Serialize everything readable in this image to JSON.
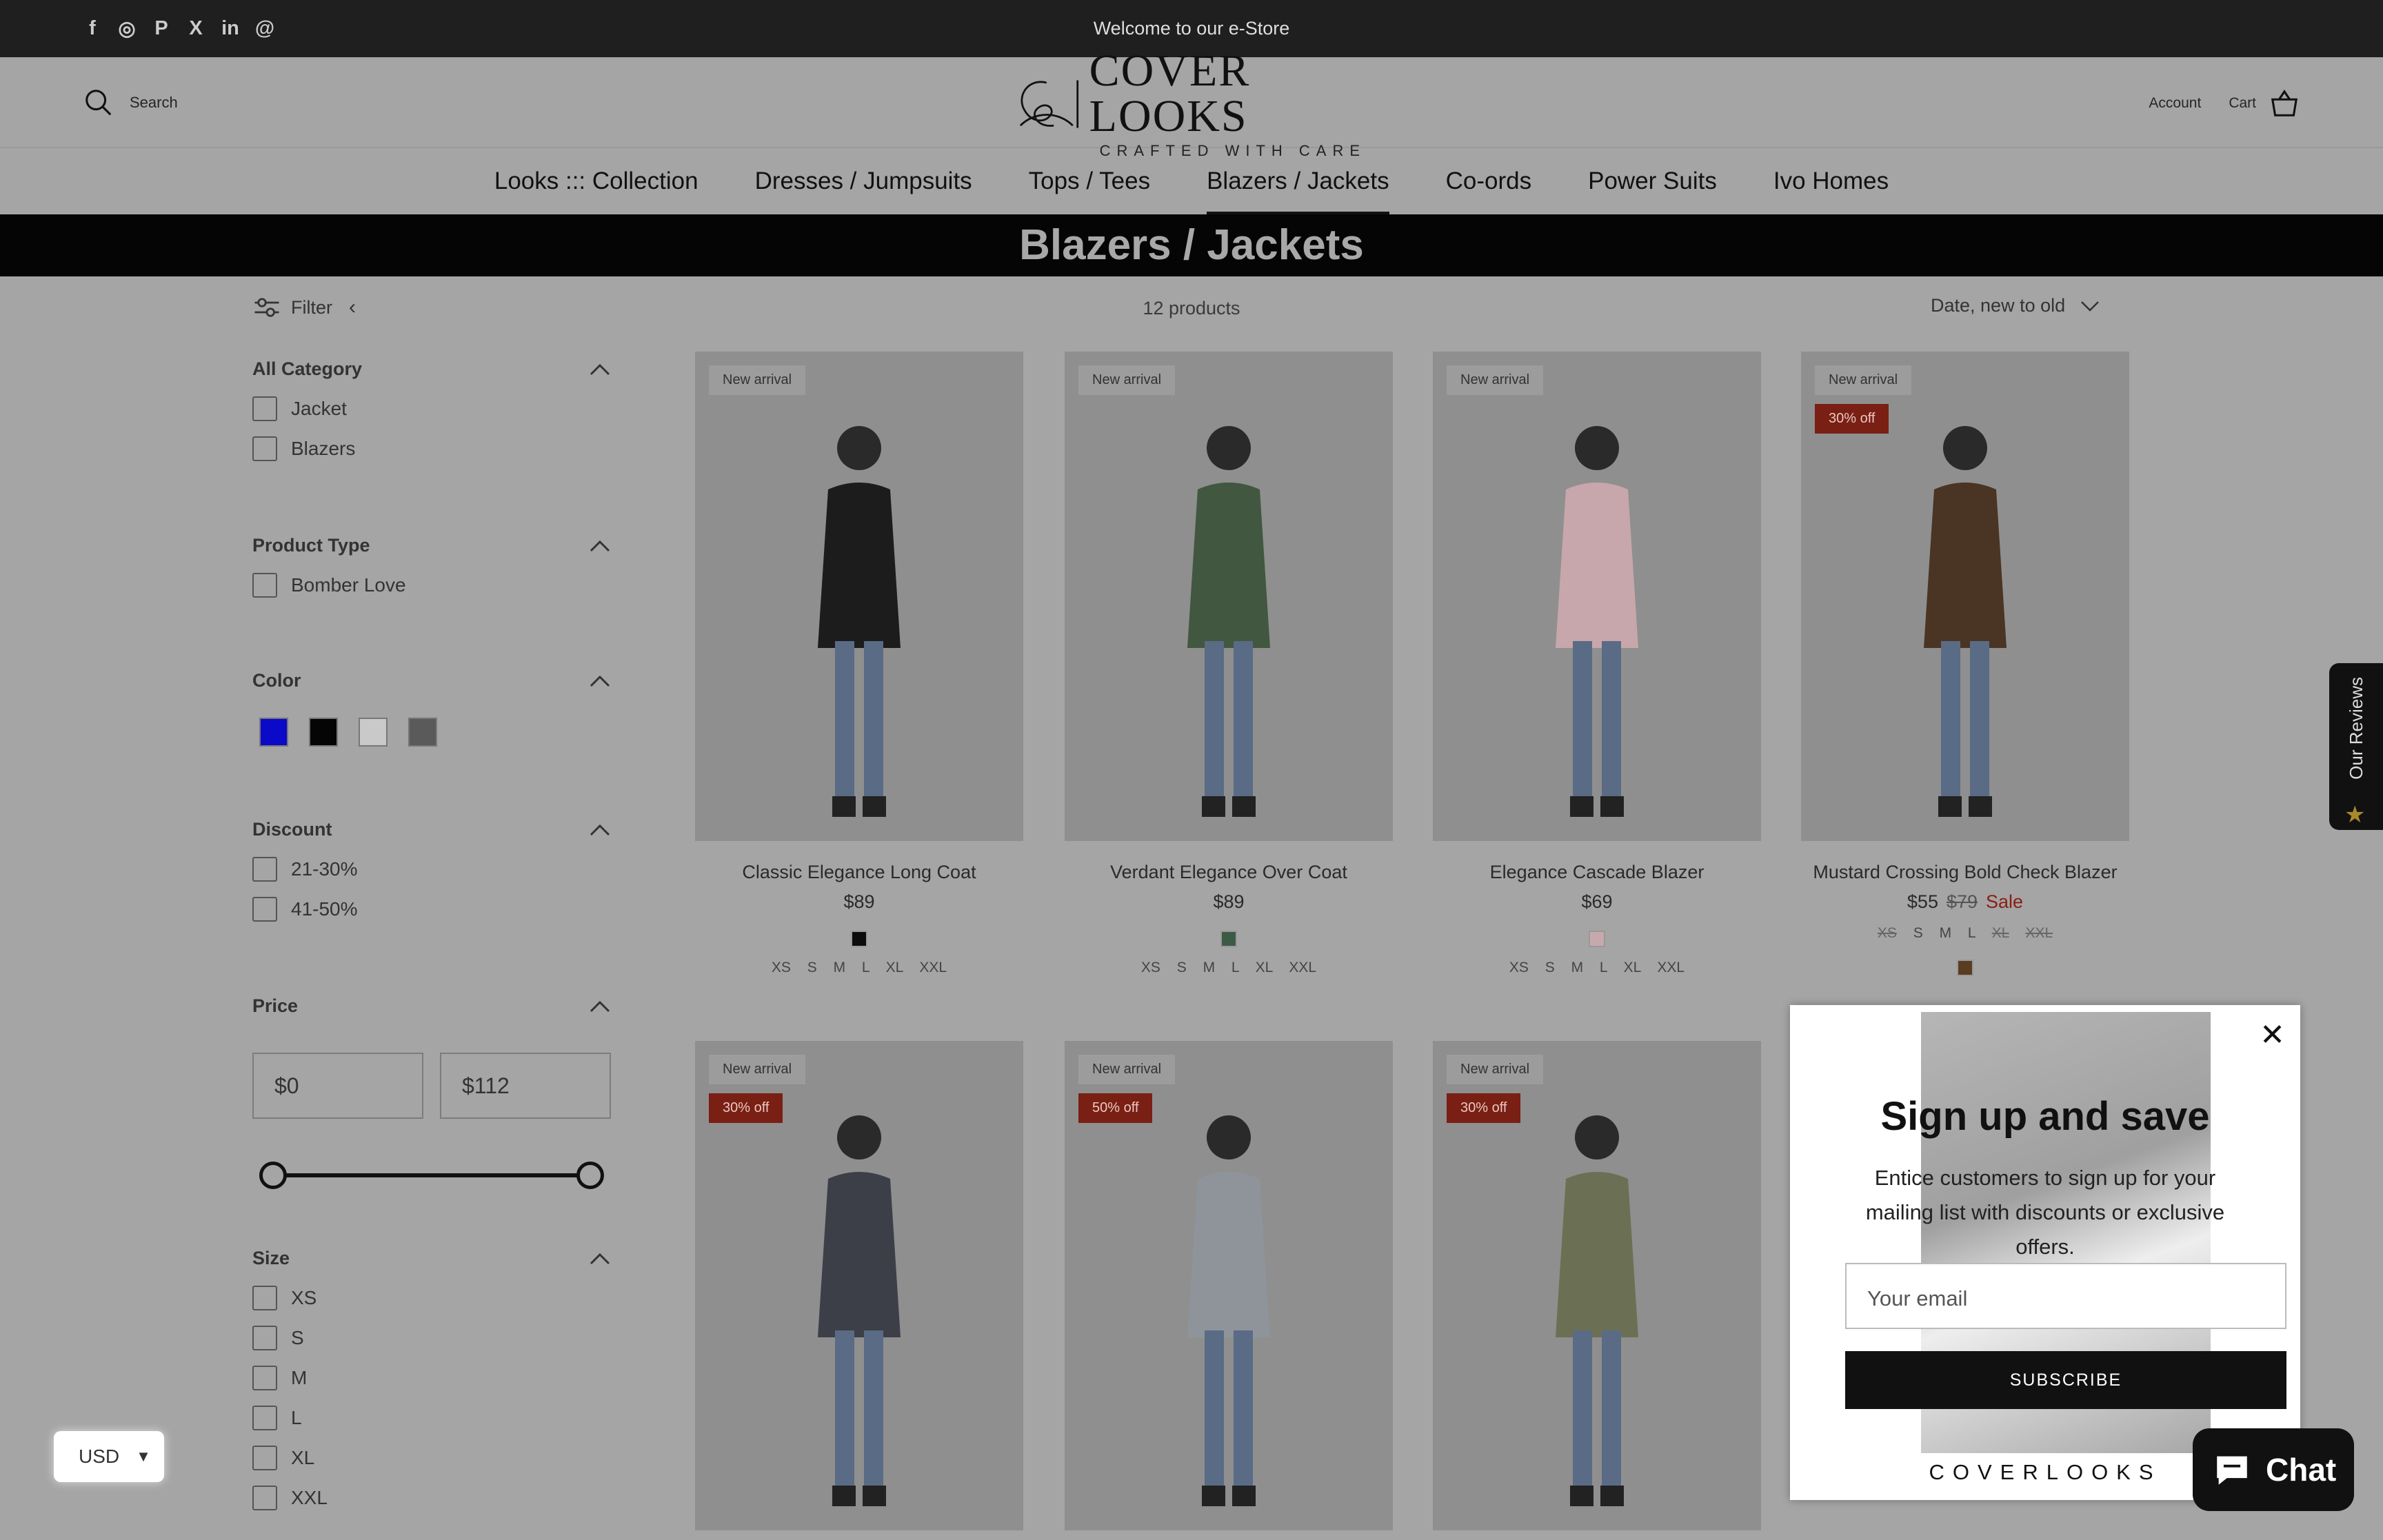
{
  "topbar": {
    "social": [
      "facebook-icon",
      "instagram-icon",
      "pinterest-icon",
      "x-icon",
      "linkedin-icon",
      "threads-icon"
    ],
    "social_glyphs": [
      "f",
      "◎",
      "P",
      "X",
      "in",
      "@"
    ],
    "welcome": "Welcome to our e-Store"
  },
  "header": {
    "search_label": "Search",
    "logo_main": "COVER LOOKS",
    "logo_sub": "CRAFTED WITH CARE",
    "account_label": "Account",
    "cart_label": "Cart"
  },
  "nav": [
    {
      "label": "Looks ::: Collection"
    },
    {
      "label": "Dresses / Jumpsuits"
    },
    {
      "label": "Tops / Tees"
    },
    {
      "label": "Blazers / Jackets",
      "active": true
    },
    {
      "label": "Co-ords"
    },
    {
      "label": "Power Suits"
    },
    {
      "label": "Ivo Homes"
    }
  ],
  "banner_title": "Blazers / Jackets",
  "toolbar": {
    "filter_label": "Filter",
    "product_count": "12 products",
    "sort_label": "Date, new to old"
  },
  "filters": {
    "category": {
      "title": "All Category",
      "options": [
        "Jacket",
        "Blazers"
      ]
    },
    "product_type": {
      "title": "Product Type",
      "options": [
        "Bomber Love"
      ]
    },
    "color": {
      "title": "Color",
      "swatches": [
        "#0a0ac8",
        "#050505",
        "#c9c9c9",
        "#5a5a5a"
      ]
    },
    "discount": {
      "title": "Discount",
      "options": [
        "21-30%",
        "41-50%"
      ]
    },
    "price": {
      "title": "Price",
      "min": "$0",
      "max": "$112"
    },
    "size": {
      "title": "Size",
      "options": [
        "XS",
        "S",
        "M",
        "L",
        "XL",
        "XXL"
      ]
    }
  },
  "products": [
    {
      "title": "Classic Elegance Long Coat",
      "price": "$89",
      "badge": "New arrival",
      "swatch": "#0c0c0c",
      "sizes": "XS S M L XL XXL",
      "garment": "#1c1c1c"
    },
    {
      "title": "Verdant Elegance Over Coat",
      "price": "$89",
      "badge": "New arrival",
      "swatch": "#3d5a45",
      "sizes": "XS S M L XL XXL",
      "garment": "#41573f"
    },
    {
      "title": "Elegance Cascade Blazer",
      "price": "$69",
      "badge": "New arrival",
      "swatch": "#c7a9ad",
      "sizes": "XS S M L XL XXL",
      "garment": "#c7a7ab"
    },
    {
      "title": "Mustard Crossing Bold Check Blazer",
      "price": "$55",
      "was": "$79",
      "sale": "Sale",
      "badge": "New arrival",
      "discount": "30% off",
      "swatch": "#5a3c22",
      "sizes_available": [
        "S",
        "M",
        "L"
      ],
      "sizes_sold_out": [
        "XS",
        "XL",
        "XXL"
      ],
      "garment": "#4a3424"
    },
    {
      "badge": "New arrival",
      "discount": "30% off",
      "garment": "#3c3f47"
    },
    {
      "badge": "New arrival",
      "discount": "50% off",
      "garment": "#8e949a"
    },
    {
      "badge": "New arrival",
      "discount": "30% off",
      "garment": "#6b7055"
    }
  ],
  "reviews_tab": "Our Reviews",
  "popup": {
    "title": "Sign up and save",
    "text": "Entice customers to sign up for your mailing list with discounts or exclusive offers.",
    "email_placeholder": "Your email",
    "button": "SUBSCRIBE",
    "brand": "COVERLOOKS"
  },
  "chat_label": "Chat",
  "currency": "USD"
}
